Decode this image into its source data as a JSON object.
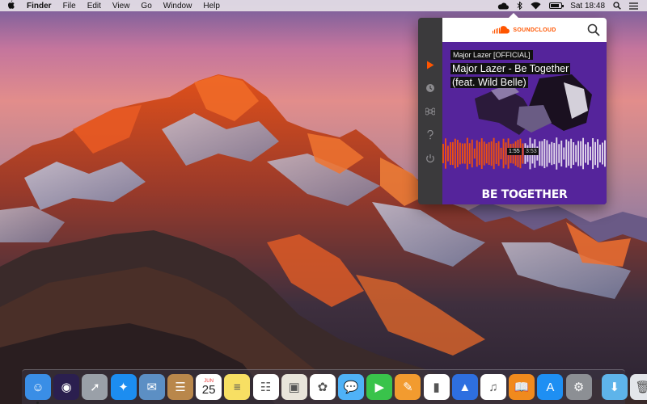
{
  "menubar": {
    "apple_icon": "apple-logo",
    "app_name": "Finder",
    "menus": [
      "File",
      "Edit",
      "View",
      "Go",
      "Window",
      "Help"
    ],
    "status": {
      "icons": [
        "soundcloud-cloud-icon",
        "bluetooth-icon",
        "wifi-icon",
        "battery-icon",
        "search-icon",
        "list-icon"
      ],
      "battery_level": 0.85,
      "clock": "Sat 18:48"
    }
  },
  "soundcloud": {
    "brand": "SOUNDCLOUD",
    "brand_color": "#ff5500",
    "sidebar": [
      "play-icon",
      "history-icon",
      "shortcut-icon",
      "help-icon",
      "power-icon"
    ],
    "now_playing": {
      "artist": "Major Lazer [OFFICIAL]",
      "title_line1": "Major Lazer - Be Together",
      "title_line2": "(feat. Wild Belle)",
      "elapsed": "1:55",
      "duration": "3:53",
      "progress": 0.49,
      "artwork_text": "BE TOGETHER"
    }
  },
  "dock": {
    "items": [
      {
        "name": "finder",
        "icon": "finder-icon",
        "color": "#3a8ee6",
        "running": true
      },
      {
        "name": "siri",
        "icon": "siri-icon",
        "color": "#2b1f4f",
        "running": false
      },
      {
        "name": "launchpad",
        "icon": "rocket-icon",
        "color": "#9aa0a8",
        "running": false
      },
      {
        "name": "safari",
        "icon": "compass-icon",
        "color": "#1c8df0",
        "running": false
      },
      {
        "name": "mail",
        "icon": "stamp-icon",
        "color": "#5c8fc4",
        "running": false
      },
      {
        "name": "contacts",
        "icon": "contacts-icon",
        "color": "#b9874b",
        "running": false
      },
      {
        "name": "calendar",
        "icon": "calendar-icon",
        "color": "#ffffff",
        "running": false,
        "month": "JUN",
        "day": "25"
      },
      {
        "name": "notes",
        "icon": "notes-icon",
        "color": "#f7df63",
        "running": false
      },
      {
        "name": "reminders",
        "icon": "reminders-icon",
        "color": "#ffffff",
        "running": false
      },
      {
        "name": "preview",
        "icon": "preview-icon",
        "color": "#e9e4da",
        "running": false
      },
      {
        "name": "photos",
        "icon": "photos-icon",
        "color": "#ffffff",
        "running": false
      },
      {
        "name": "messages",
        "icon": "messages-icon",
        "color": "#4fb2f7",
        "running": false
      },
      {
        "name": "facetime",
        "icon": "facetime-icon",
        "color": "#39c34b",
        "running": false
      },
      {
        "name": "pages",
        "icon": "pages-icon",
        "color": "#f29b2f",
        "running": false
      },
      {
        "name": "numbers",
        "icon": "numbers-icon",
        "color": "#ffffff",
        "running": false
      },
      {
        "name": "keynote",
        "icon": "keynote-icon",
        "color": "#2e6fe0",
        "running": false
      },
      {
        "name": "itunes",
        "icon": "music-note-icon",
        "color": "#ffffff",
        "running": false
      },
      {
        "name": "ibooks",
        "icon": "book-icon",
        "color": "#f08a1d",
        "running": false
      },
      {
        "name": "app-store",
        "icon": "app-store-icon",
        "color": "#1e8ff3",
        "running": false
      },
      {
        "name": "system-preferences",
        "icon": "gear-icon",
        "color": "#8c8f94",
        "running": false
      }
    ],
    "right_items": [
      {
        "name": "downloads",
        "icon": "downloads-folder-icon",
        "color": "#5eb4ea"
      },
      {
        "name": "trash",
        "icon": "trash-icon",
        "color": "#e3e6ea"
      }
    ]
  }
}
